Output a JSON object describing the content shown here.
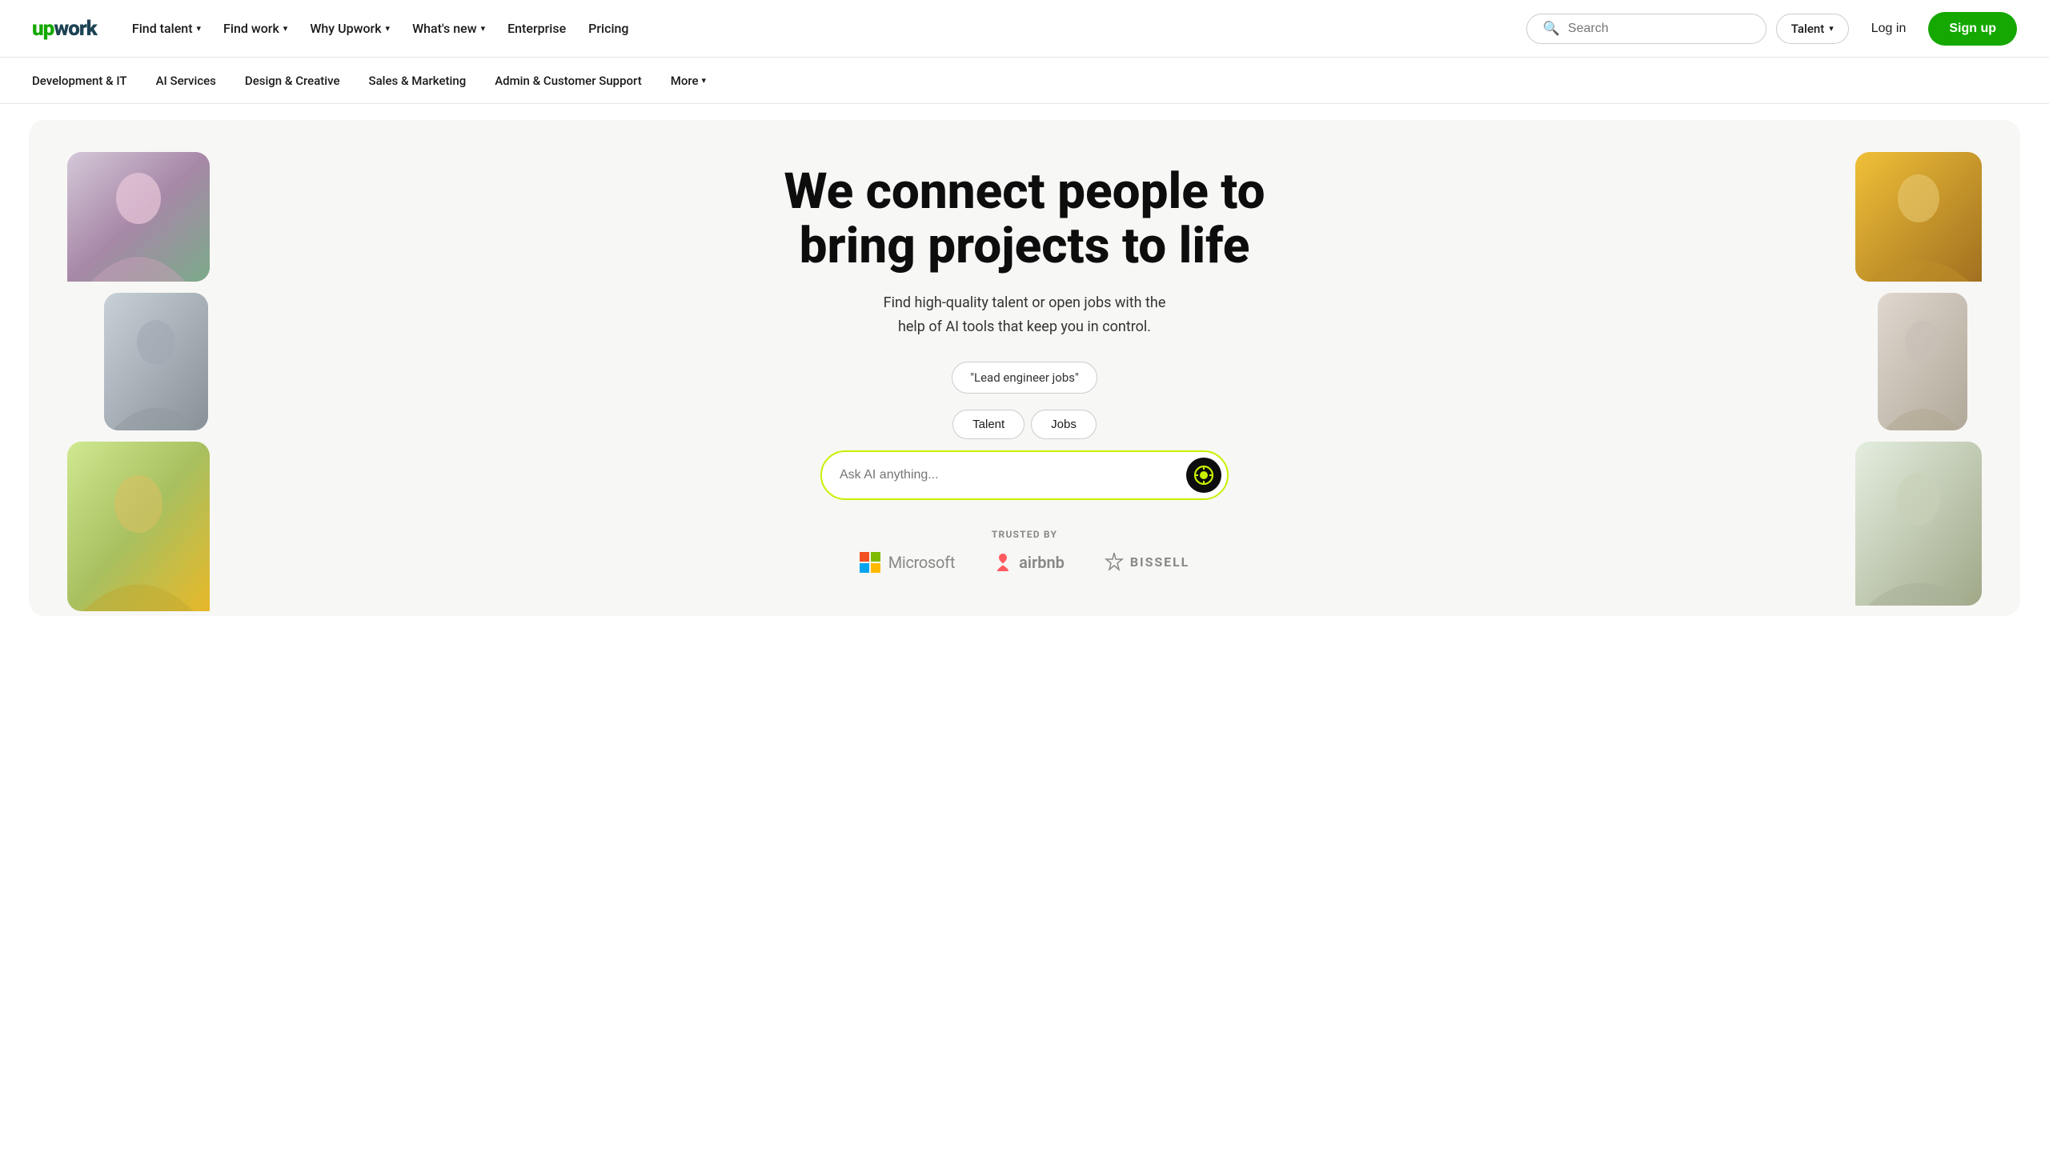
{
  "logo": {
    "text": "upwork"
  },
  "topNav": {
    "links": [
      {
        "label": "Find talent",
        "hasDropdown": true
      },
      {
        "label": "Find work",
        "hasDropdown": true
      },
      {
        "label": "Why Upwork",
        "hasDropdown": true
      },
      {
        "label": "What's new",
        "hasDropdown": true
      },
      {
        "label": "Enterprise",
        "hasDropdown": false
      }
    ],
    "pricing": "Pricing",
    "searchPlaceholder": "Search",
    "talentLabel": "Talent",
    "loginLabel": "Log in",
    "signupLabel": "Sign up"
  },
  "secondNav": {
    "links": [
      {
        "label": "Development & IT"
      },
      {
        "label": "AI Services"
      },
      {
        "label": "Design & Creative"
      },
      {
        "label": "Sales & Marketing"
      },
      {
        "label": "Admin & Customer Support"
      },
      {
        "label": "More",
        "hasDropdown": true
      }
    ]
  },
  "hero": {
    "title": "We connect people to bring projects to life",
    "subtitle": "Find high-quality talent or open jobs with the\nhelp of AI tools that keep you in control.",
    "tabs": [
      {
        "label": "Talent",
        "active": false
      },
      {
        "label": "Jobs",
        "active": false
      }
    ],
    "suggestionPill": "\"Lead engineer jobs\"",
    "aiInputPlaceholder": "Ask AI anything...",
    "trustedBy": {
      "label": "TRUSTED BY",
      "logos": [
        {
          "name": "Microsoft"
        },
        {
          "name": "airbnb"
        },
        {
          "name": "BISSELL"
        }
      ]
    }
  }
}
